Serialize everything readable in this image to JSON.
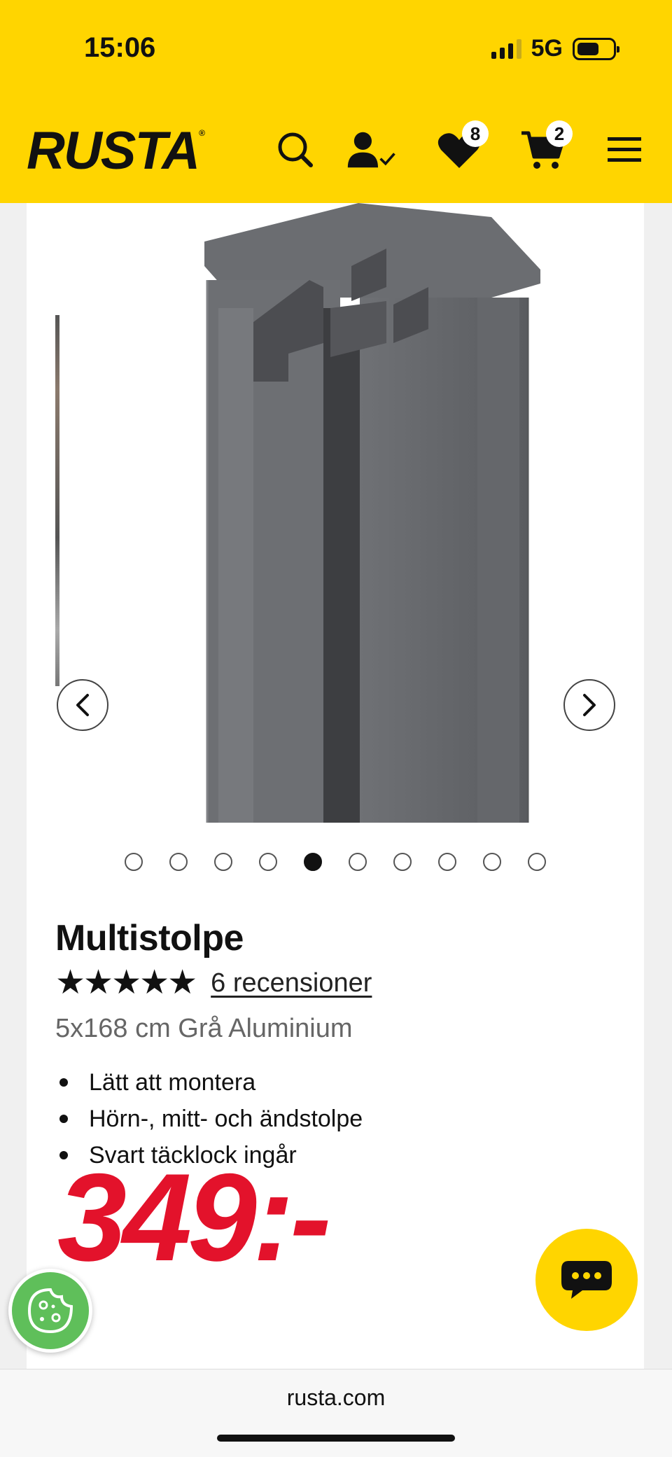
{
  "status_bar": {
    "time": "15:06",
    "network": "5G"
  },
  "header": {
    "logo": "RUSTA",
    "wishlist_count": "8",
    "cart_count": "2",
    "icons": [
      "search-icon",
      "account-icon",
      "heart-icon",
      "cart-icon",
      "menu-icon"
    ]
  },
  "gallery": {
    "total_images": 10,
    "active_index": 5
  },
  "product": {
    "title": "Multistolpe",
    "rating": "★★★★★",
    "reviews_link": "6 recensioner",
    "subtitle": "5x168 cm Grå Aluminium",
    "features": [
      "Lätt att montera",
      "Hörn-, mitt- och ändstolpe",
      "Svart täcklock ingår"
    ],
    "price": "349:-"
  },
  "browser": {
    "url": "rusta.com"
  },
  "colors": {
    "brand_yellow": "#FFD500",
    "price_red": "#E3122B",
    "cookie_green": "#5FBF5A"
  }
}
